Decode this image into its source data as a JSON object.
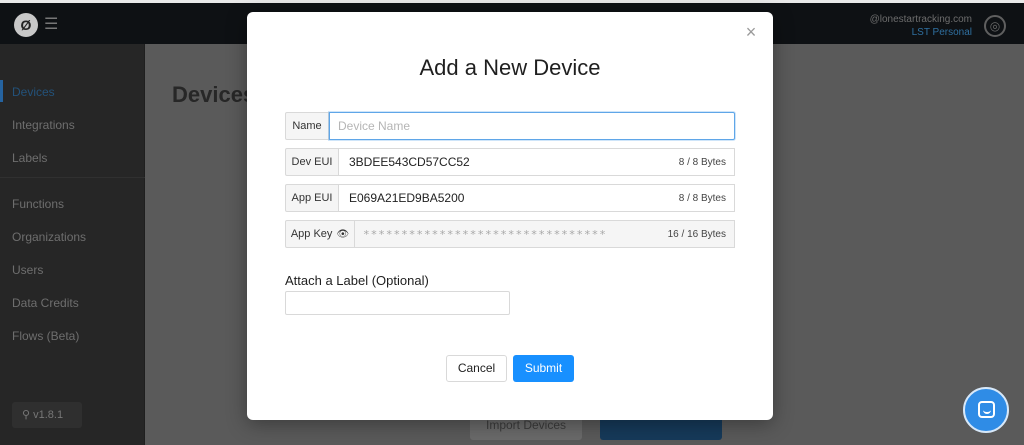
{
  "topbar": {
    "logo_glyph": "Ø",
    "menu_glyph": "☰",
    "email": "@lonestartracking.com",
    "plan": "LST Personal",
    "account_glyph": "◎"
  },
  "sidebar": {
    "items": [
      {
        "label": "Devices",
        "active": true
      },
      {
        "label": "Integrations"
      },
      {
        "label": "Labels"
      },
      {
        "label": "Functions"
      },
      {
        "label": "Organizations"
      },
      {
        "label": "Users"
      },
      {
        "label": "Data Credits"
      },
      {
        "label": "Flows (Beta)"
      }
    ],
    "version": "v1.8.1",
    "version_glyph": "⚲"
  },
  "main": {
    "title": "Devices",
    "import_label": "Import Devices"
  },
  "modal": {
    "title": "Add a New Device",
    "close_glyph": "×",
    "name": {
      "label": "Name",
      "placeholder": "Device Name",
      "value": ""
    },
    "dev_eui": {
      "label": "Dev EUI",
      "value": "3BDEE543CD57CC52",
      "count": "8 / 8 Bytes"
    },
    "app_eui": {
      "label": "App EUI",
      "value": "E069A21ED9BA5200",
      "count": "8 / 8 Bytes"
    },
    "app_key": {
      "label": "App Key",
      "eye_glyph": "👁",
      "masked": "********************************",
      "count": "16 / 16 Bytes"
    },
    "label_section": {
      "title": "Attach a Label (Optional)",
      "value": ""
    },
    "cancel_label": "Cancel",
    "submit_label": "Submit"
  },
  "colors": {
    "primary": "#1890ff",
    "chat": "#2f8ce6"
  }
}
